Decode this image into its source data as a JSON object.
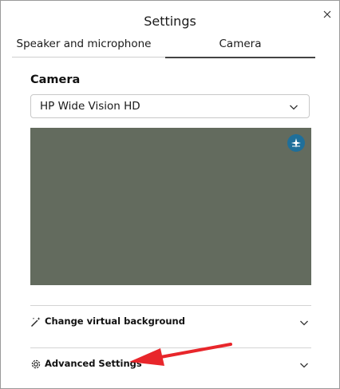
{
  "window": {
    "title": "Settings"
  },
  "tabs": [
    {
      "label": "Speaker and microphone",
      "selected": false
    },
    {
      "label": "Camera",
      "selected": true
    }
  ],
  "camera": {
    "heading": "Camera",
    "device_selected": "HP Wide Vision HD"
  },
  "options": [
    {
      "label": "Change virtual background",
      "icon": "magic-wand-icon"
    },
    {
      "label": "Advanced Settings",
      "icon": "gear-icon"
    }
  ],
  "colors": {
    "preview_bg": "#636b5e",
    "badge_bg": "#1f6f9a",
    "annotation_arrow": "#e8262b"
  }
}
